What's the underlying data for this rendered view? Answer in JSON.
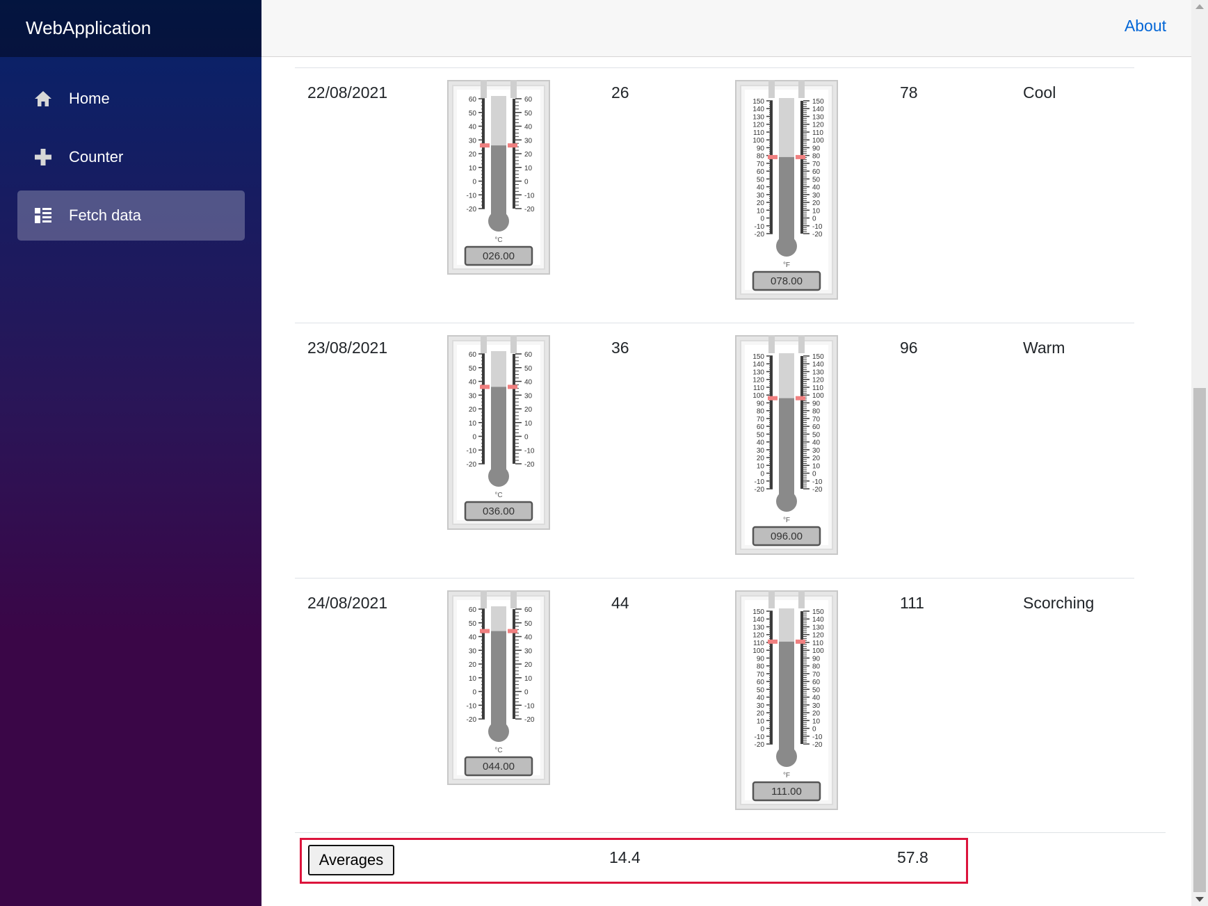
{
  "app": {
    "brand": "WebApplication"
  },
  "sidebar": {
    "items": [
      {
        "label": "Home",
        "icon": "home-icon",
        "active": false
      },
      {
        "label": "Counter",
        "icon": "plus-icon",
        "active": false
      },
      {
        "label": "Fetch data",
        "icon": "list-icon",
        "active": true
      }
    ]
  },
  "topbar": {
    "about": "About"
  },
  "forecasts": [
    {
      "date": "22/08/2021",
      "temp_c": 26,
      "temp_f": 78,
      "summary": "Cool",
      "c_readout": "026.00",
      "f_readout": "078.00"
    },
    {
      "date": "23/08/2021",
      "temp_c": 36,
      "temp_f": 96,
      "summary": "Warm",
      "c_readout": "036.00",
      "f_readout": "096.00"
    },
    {
      "date": "24/08/2021",
      "temp_c": 44,
      "temp_f": 111,
      "summary": "Scorching",
      "c_readout": "044.00",
      "f_readout": "111.00"
    }
  ],
  "gauge_scales": {
    "celsius": {
      "unit": "°C",
      "ticks": [
        "60",
        "50",
        "40",
        "30",
        "20",
        "10",
        "0",
        "-10",
        "-20"
      ],
      "min": -20,
      "max": 60
    },
    "fahrenheit": {
      "unit": "°F",
      "ticks": [
        "150",
        "140",
        "130",
        "120",
        "110",
        "100",
        "90",
        "80",
        "70",
        "60",
        "50",
        "40",
        "30",
        "20",
        "10",
        "0",
        "-10",
        "-20"
      ],
      "min": -20,
      "max": 150
    }
  },
  "averages": {
    "button_label": "Averages",
    "temp_c": "14.4",
    "temp_f": "57.8"
  },
  "colors": {
    "accent_border": "#dc143c",
    "link": "#0366d6",
    "marker": "#f08080"
  }
}
